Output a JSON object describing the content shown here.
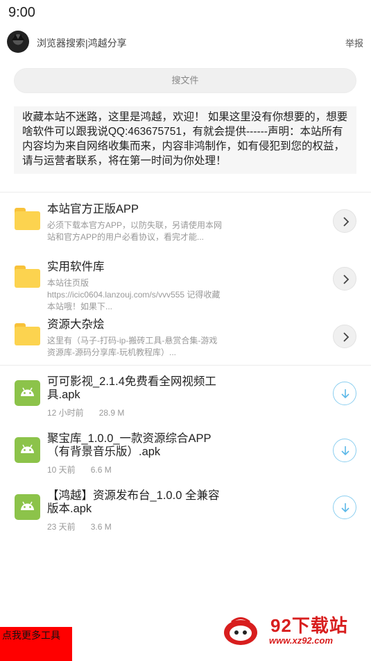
{
  "status_bar": {
    "time": "9:00"
  },
  "header": {
    "title": "浏览器搜索|鸿越分享",
    "report": "举报"
  },
  "search": {
    "placeholder": "搜文件"
  },
  "notice": "收藏本站不迷路，这里是鸿越，欢迎！ 如果这里没有你想要的，想要啥软件可以跟我说QQ:463675751，有就会提供------声明：本站所有内容均为来自网络收集而来，内容非鸿制作，如有侵犯到您的权益，请与运营者联系，将在第一时间为你处理！",
  "folders": [
    {
      "title": "本站官方正版APP",
      "desc": "必须下载本官方APP，以防失联，另请使用本网站和官方APP的用户必看协议，看完才能..."
    },
    {
      "title": "实用软件库",
      "desc": "本站往页版 https://icic0604.lanzouj.com/s/vvv555 记得收藏本站哦！如果下..."
    },
    {
      "title": "资源大杂烩",
      "desc": "这里有（马子-打码-ip-搬砖工具-悬赏合集-游戏资源库-源码分享库-玩机教程库）..."
    }
  ],
  "files": [
    {
      "name": "可可影视_2.1.4免费看全网视频工具.apk",
      "time": "12 小时前",
      "size": "28.9 M"
    },
    {
      "name": "聚宝库_1.0.0_一款资源综合APP（有背景音乐版）.apk",
      "time": "10 天前",
      "size": "6.6 M"
    },
    {
      "name": "【鸿越】资源发布台_1.0.0 全兼容版本.apk",
      "time": "23 天前",
      "size": "3.6 M"
    }
  ],
  "footer": {
    "more_tools": "点我更多工具"
  },
  "watermark": {
    "name": "92下载站",
    "url": "www.xz92.com"
  },
  "colors": {
    "folder": "#fcd34f",
    "apk": "#8cc34a",
    "download": "#5bb8e8",
    "more_tools_bg": "#ff0000",
    "watermark": "#d81e1e"
  }
}
